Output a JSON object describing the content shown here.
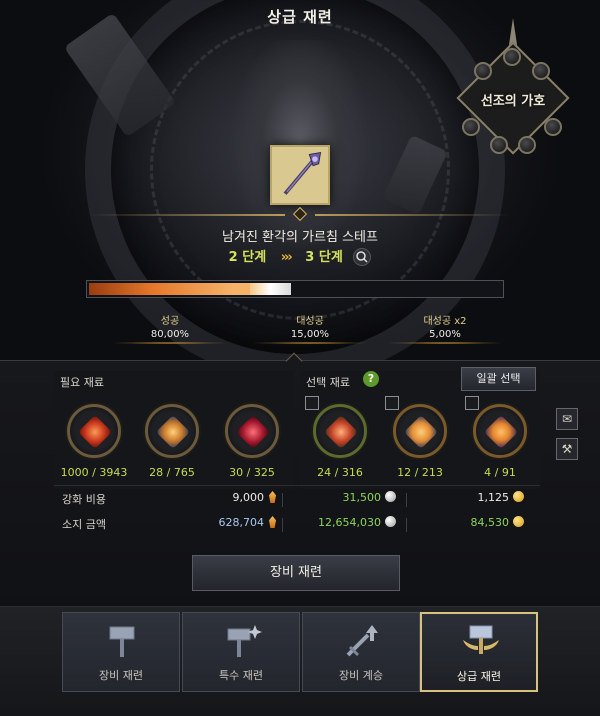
{
  "title": "상급 재련",
  "ancestor_button": {
    "label": "선조의 가호"
  },
  "item": {
    "name": "남겨진 환각의 가르침 스테프",
    "stage_from": "2 단계",
    "stage_arrows": "›››",
    "stage_to": "3 단계",
    "progress": 0.49,
    "progress_glow_start": 0.39
  },
  "rates": [
    {
      "label": "성공",
      "value": "80,00%"
    },
    {
      "label": "대성공",
      "value": "15,00%"
    },
    {
      "label": "대성공 x2",
      "value": "5,00%"
    }
  ],
  "required": {
    "label": "필요 재료",
    "items": [
      {
        "icon": "red-crystal-icon",
        "count": "1000 / 3943",
        "color": "#d9481f"
      },
      {
        "icon": "blue-orange-crystal-icon",
        "count": "28 / 765",
        "color": "#e0a23a"
      },
      {
        "icon": "crimson-gem-icon",
        "count": "30 / 325",
        "color": "#b3243a"
      }
    ]
  },
  "optional": {
    "label": "선택 재료",
    "help": "?",
    "bulk_select": "일괄 선택",
    "items": [
      {
        "icon": "red-scroll-icon",
        "count": "24 / 316",
        "color": "#c8452a"
      },
      {
        "icon": "blue-scroll-icon",
        "count": "12 / 213",
        "color": "#e28b34"
      },
      {
        "icon": "orange-orb-icon",
        "count": "4 / 91",
        "color": "#e3852c"
      }
    ]
  },
  "side_buttons": {
    "mail": "✉",
    "hammer": "⚒"
  },
  "costs": {
    "cost_label": "강화 비용",
    "owned_label": "소지 금액",
    "cost_values": [
      "9,000",
      "31,500",
      "1,125"
    ],
    "owned_values": [
      "628,704",
      "12,654,030",
      "84,530"
    ]
  },
  "main_button": "장비 재련",
  "tabs": [
    {
      "label": "장비 재련",
      "icon": "hammer-icon"
    },
    {
      "label": "특수 재련",
      "icon": "sparkle-hammer-icon"
    },
    {
      "label": "장비 계승",
      "icon": "sword-up-icon"
    },
    {
      "label": "상급 재련",
      "icon": "winged-hammer-icon",
      "active": true
    }
  ],
  "colors": {
    "accent_gold": "#d8c280",
    "count_green": "#c7dc4f",
    "stage_yellow": "#d6e35a",
    "owned_blue": "#a9c7ee",
    "owned_green": "#8fd35c",
    "help_green": "#5e9a2a"
  }
}
